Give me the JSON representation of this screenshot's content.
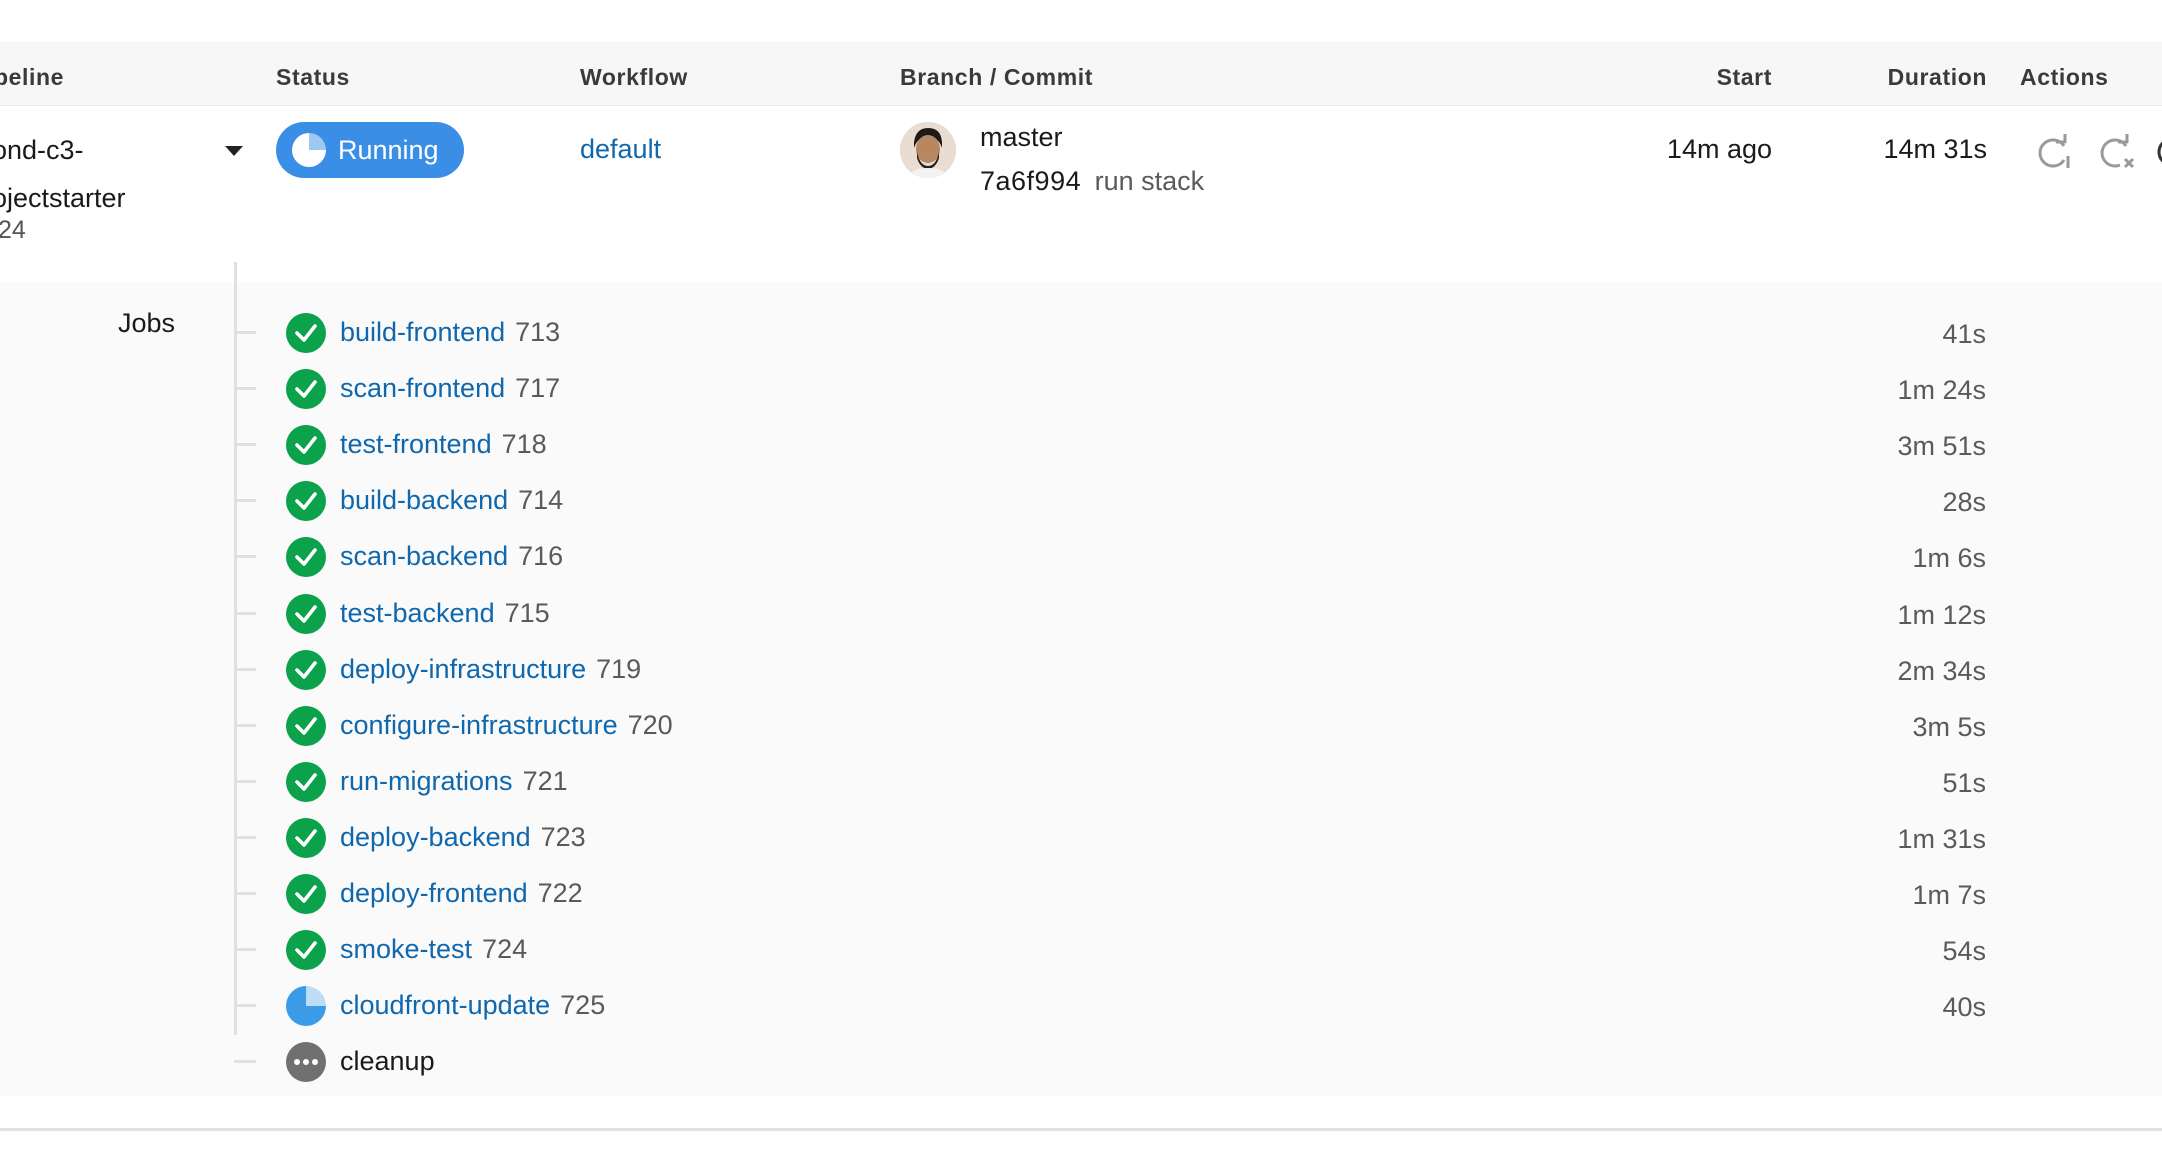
{
  "headers": {
    "pipeline": "peline",
    "status": "Status",
    "workflow": "Workflow",
    "branch_commit": "Branch / Commit",
    "start": "Start",
    "duration": "Duration",
    "actions": "Actions"
  },
  "pipeline": {
    "name_line1": "ond-c3-",
    "name_line2": "ojectstarter",
    "number": "24",
    "status": "Running",
    "workflow": "default",
    "branch": "master",
    "commit_hash": "7a6f994",
    "commit_message": "run stack",
    "start": "14m ago",
    "duration": "14m 31s"
  },
  "actions": {
    "rerun_icon": "rerun-icon",
    "cancel_icon": "cancel-rerun-icon"
  },
  "jobs_label": "Jobs",
  "jobs": [
    {
      "name": "build-frontend",
      "number": "713",
      "duration": "41s",
      "status": "success"
    },
    {
      "name": "scan-frontend",
      "number": "717",
      "duration": "1m 24s",
      "status": "success"
    },
    {
      "name": "test-frontend",
      "number": "718",
      "duration": "3m 51s",
      "status": "success"
    },
    {
      "name": "build-backend",
      "number": "714",
      "duration": "28s",
      "status": "success"
    },
    {
      "name": "scan-backend",
      "number": "716",
      "duration": "1m 6s",
      "status": "success"
    },
    {
      "name": "test-backend",
      "number": "715",
      "duration": "1m 12s",
      "status": "success"
    },
    {
      "name": "deploy-infrastructure",
      "number": "719",
      "duration": "2m 34s",
      "status": "success"
    },
    {
      "name": "configure-infrastructure",
      "number": "720",
      "duration": "3m 5s",
      "status": "success"
    },
    {
      "name": "run-migrations",
      "number": "721",
      "duration": "51s",
      "status": "success"
    },
    {
      "name": "deploy-backend",
      "number": "723",
      "duration": "1m 31s",
      "status": "success"
    },
    {
      "name": "deploy-frontend",
      "number": "722",
      "duration": "1m 7s",
      "status": "success"
    },
    {
      "name": "smoke-test",
      "number": "724",
      "duration": "54s",
      "status": "success"
    },
    {
      "name": "cloudfront-update",
      "number": "725",
      "duration": "40s",
      "status": "running"
    },
    {
      "name": "cleanup",
      "number": "",
      "duration": "",
      "status": "pending"
    }
  ],
  "colors": {
    "success": "#0ba24b",
    "running": "#3a8ee6",
    "link": "#0f67ad",
    "pending": "#707070"
  }
}
